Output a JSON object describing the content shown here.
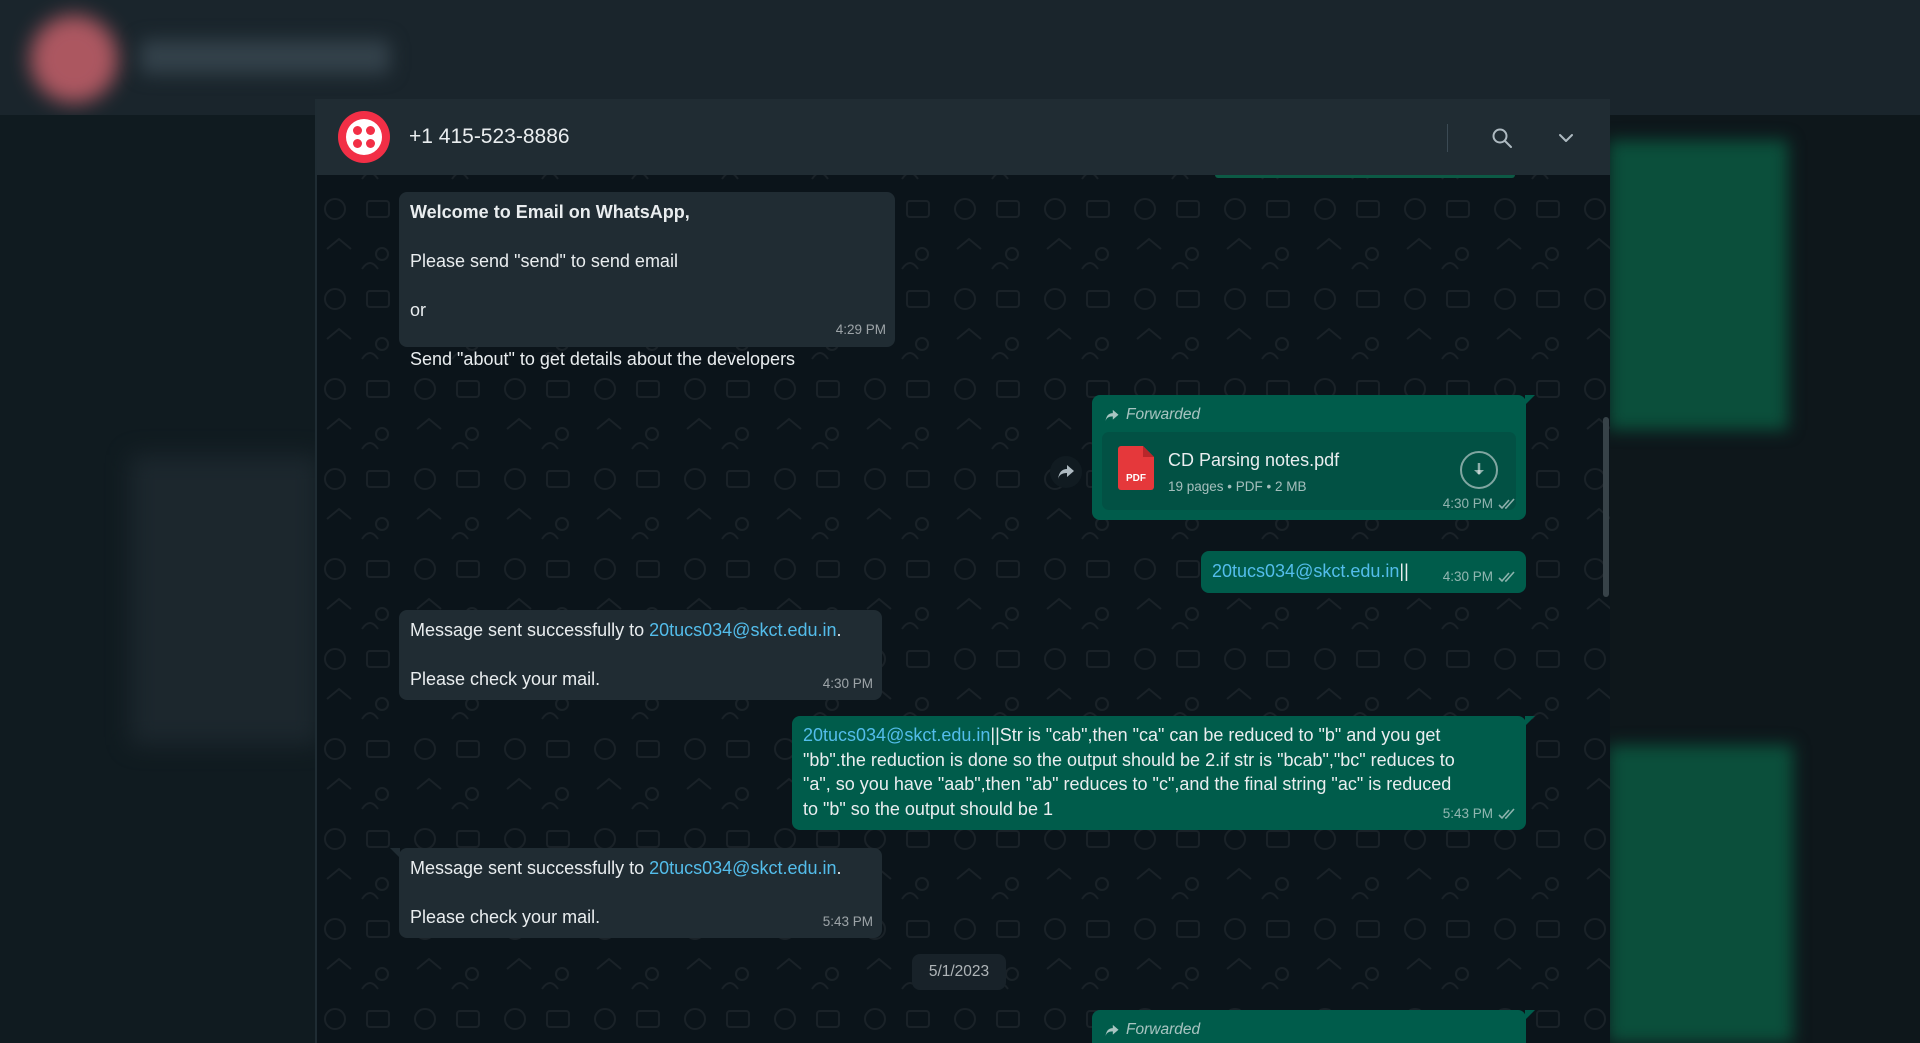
{
  "header": {
    "contact_name": "+1 415-523-8886",
    "search_icon": "search-icon",
    "menu_icon": "chevron-down-icon"
  },
  "messages": {
    "welcome": {
      "line1": "Welcome to Email on WhatsApp,",
      "line2": "Please send \"send\" to send email",
      "line3": "or",
      "line4": "Send \"about\" to get details about the developers",
      "time": "4:29 PM"
    },
    "doc": {
      "forwarded": "Forwarded",
      "file_name": "CD Parsing notes.pdf",
      "icon_text": "PDF",
      "meta": "19 pages • PDF • 2 MB",
      "time": "4:30 PM"
    },
    "email_out": {
      "email": "20tucs034@skct.edu.in",
      "suffix": "||",
      "time": "4:30 PM"
    },
    "sent1": {
      "prefix": "Message sent successfully to ",
      "email": "20tucs034@skct.edu.in",
      "period": ".",
      "line2": "Please check your mail.",
      "time": "4:30 PM"
    },
    "long_out": {
      "email": "20tucs034@skct.edu.in",
      "line1": "||Str is \"cab\",then \"ca\" can be reduced to \"b\" and you get",
      "line2": "\"bb\".the reduction is done so the output should be 2.if str is \"bcab\",\"bc\" reduces to",
      "line3": "\"a\", so you have \"aab\",then \"ab\" reduces to \"c\",and the final string \"ac\" is reduced",
      "line4": "to \"b\" so the output should be 1",
      "time": "5:43 PM"
    },
    "sent2": {
      "prefix": "Message sent successfully to ",
      "email": "20tucs034@skct.edu.in",
      "period": ".",
      "line2": "Please check your mail.",
      "time": "5:43 PM"
    },
    "date_divider": "5/1/2023",
    "bottom_forwarded": "Forwarded"
  },
  "colors": {
    "outgoing_bubble": "#005c4b",
    "incoming_bubble": "#202c33",
    "link": "#53bdeb",
    "avatar_brand": "#f22f46"
  }
}
